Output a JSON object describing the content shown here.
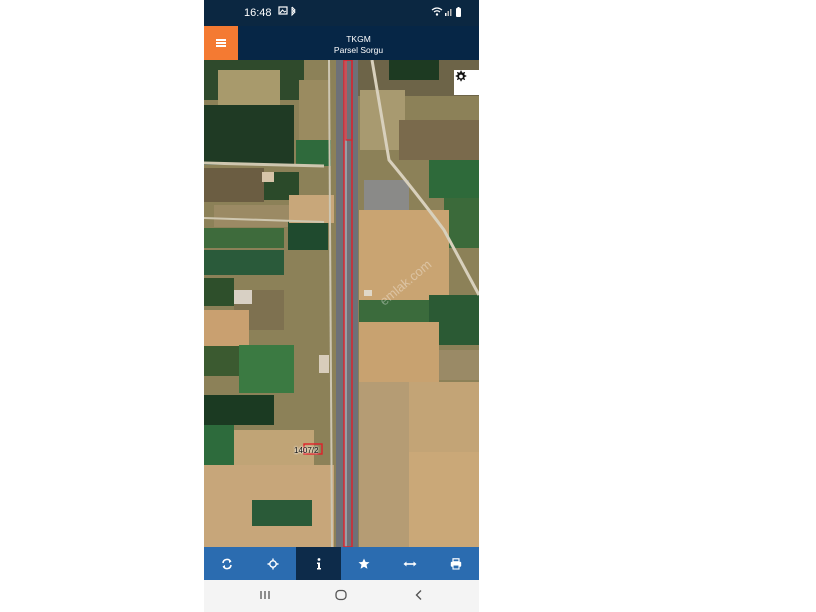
{
  "status_bar": {
    "time": "16:48",
    "left_icons": [
      "gallery-icon",
      "bluetooth-icon"
    ],
    "right_icons": [
      "wifi-icon",
      "signal-icon",
      "battery-icon"
    ]
  },
  "app_bar": {
    "title_line1": "TKGM",
    "title_line2": "Parsel Sorgu",
    "menu_icon": "hamburger-menu-icon",
    "accent_color": "#f47a32",
    "bar_color": "#062646"
  },
  "map": {
    "parcel_label": "1407/2",
    "watermark": "emlak.com",
    "settings_icon": "gear-icon",
    "highlight_color": "#e0202a"
  },
  "toolbar": {
    "color": "#2b6cb0",
    "active_color": "#0d2b4a",
    "items": [
      {
        "icon": "refresh-icon"
      },
      {
        "icon": "locate-crosshair-icon"
      },
      {
        "icon": "info-icon",
        "active": true
      },
      {
        "icon": "star-icon"
      },
      {
        "icon": "measure-arrows-icon"
      },
      {
        "icon": "print-icon"
      }
    ]
  },
  "nav_bar": {
    "items": [
      "recent-apps-icon",
      "home-icon",
      "back-icon"
    ]
  }
}
